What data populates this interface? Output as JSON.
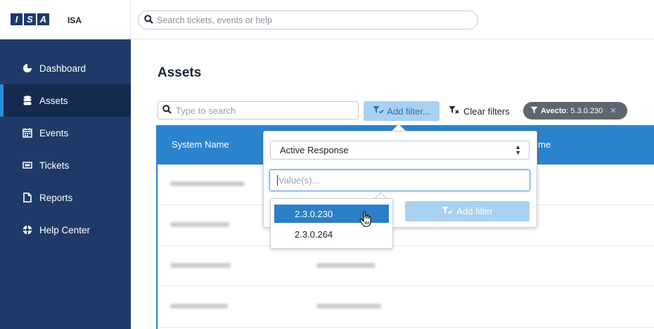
{
  "app": {
    "logo_letters": [
      "I",
      "S",
      "A"
    ],
    "name": "ISA"
  },
  "global_search": {
    "placeholder": "Search tickets, events or help"
  },
  "sidebar": {
    "items": [
      {
        "label": "Dashboard",
        "icon": "dashboard-icon",
        "active": false
      },
      {
        "label": "Assets",
        "icon": "database-icon",
        "active": true
      },
      {
        "label": "Events",
        "icon": "calendar-icon",
        "active": false
      },
      {
        "label": "Tickets",
        "icon": "ticket-icon",
        "active": false
      },
      {
        "label": "Reports",
        "icon": "document-icon",
        "active": false
      },
      {
        "label": "Help Center",
        "icon": "lifebuoy-icon",
        "active": false
      }
    ]
  },
  "main": {
    "title": "Assets",
    "search": {
      "placeholder": "Type to search"
    },
    "add_filter_label": "Add filter...",
    "clear_filters_label": "Clear filters",
    "active_filter": {
      "key": "Avecto",
      "value": ": 5.3.0.230"
    },
    "table": {
      "columns": [
        "System Name",
        "me"
      ]
    }
  },
  "filter_popover": {
    "field_select": "Active Response",
    "value_placeholder": "Value(s)...",
    "add_button_label": "Add filter"
  },
  "autocomplete": {
    "options": [
      "2.3.0.230",
      "2.3.0.264"
    ],
    "selected_index": 0
  },
  "colors": {
    "sidebar_bg": "#1f3a68",
    "sidebar_active_bg": "#142a4e",
    "accent": "#2b83ce",
    "button_light": "#a9d1f2",
    "chip_bg": "#5d6770"
  }
}
